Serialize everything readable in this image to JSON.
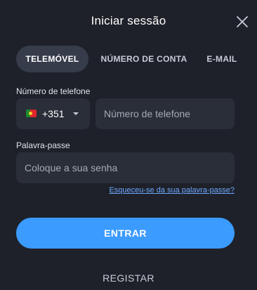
{
  "header": {
    "title": "Iniciar sessão",
    "close_icon": "close-icon"
  },
  "tabs": [
    {
      "label": "TELEMÓVEL",
      "active": true
    },
    {
      "label": "NÚMERO DE CONTA",
      "active": false
    },
    {
      "label": "E-MAIL",
      "active": false
    }
  ],
  "phone": {
    "label": "Número de telefone",
    "country_flag": "portugal-flag-icon",
    "country_code": "+351",
    "placeholder": "Número de telefone"
  },
  "password": {
    "label": "Palavra-passe",
    "placeholder": "Coloque a sua senha"
  },
  "forgot_link": "Esqueceu-se da sua palavra-passe?",
  "submit_label": "ENTRAR",
  "register_label": "REGISTAR",
  "colors": {
    "background": "#1e2129",
    "field": "#2a2e38",
    "active_tab": "#363c4a",
    "accent": "#3b9bff",
    "link": "#6ea8ff"
  }
}
